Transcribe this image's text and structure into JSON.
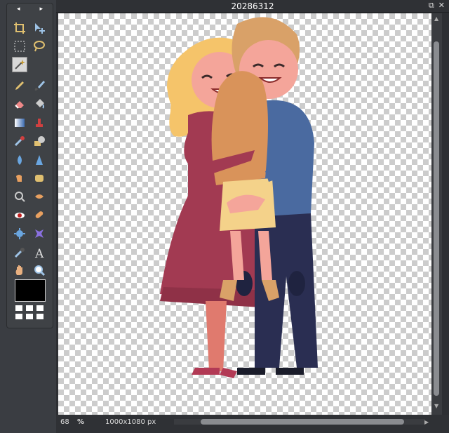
{
  "toolbox": {
    "nav_left": "◂",
    "nav_right": "▸",
    "tools": [
      {
        "name": "crop-icon",
        "row": 0,
        "col": 0
      },
      {
        "name": "move-icon",
        "row": 0,
        "col": 1
      },
      {
        "name": "marquee-icon",
        "row": 1,
        "col": 0
      },
      {
        "name": "lasso-icon",
        "row": 1,
        "col": 1
      },
      {
        "name": "magic-wand-icon",
        "row": 2,
        "col": 0,
        "active": true
      },
      {
        "name": "pencil-icon",
        "row": 3,
        "col": 0
      },
      {
        "name": "brush-icon",
        "row": 3,
        "col": 1
      },
      {
        "name": "eraser-icon",
        "row": 4,
        "col": 0
      },
      {
        "name": "paint-bucket-icon",
        "row": 4,
        "col": 1
      },
      {
        "name": "gradient-icon",
        "row": 5,
        "col": 0
      },
      {
        "name": "clone-stamp-icon",
        "row": 5,
        "col": 1
      },
      {
        "name": "color-replace-icon",
        "row": 6,
        "col": 0
      },
      {
        "name": "drawing-icon",
        "row": 6,
        "col": 1
      },
      {
        "name": "blur-icon",
        "row": 7,
        "col": 0
      },
      {
        "name": "sharpen-icon",
        "row": 7,
        "col": 1
      },
      {
        "name": "smudge-icon",
        "row": 8,
        "col": 0
      },
      {
        "name": "sponge-icon",
        "row": 8,
        "col": 1
      },
      {
        "name": "dodge-icon",
        "row": 9,
        "col": 0
      },
      {
        "name": "burn-icon",
        "row": 9,
        "col": 1
      },
      {
        "name": "red-eye-icon",
        "row": 10,
        "col": 0
      },
      {
        "name": "spot-heal-icon",
        "row": 10,
        "col": 1
      },
      {
        "name": "bloat-icon",
        "row": 11,
        "col": 0
      },
      {
        "name": "pinch-icon",
        "row": 11,
        "col": 1
      },
      {
        "name": "color-picker-icon",
        "row": 12,
        "col": 0
      },
      {
        "name": "type-icon",
        "row": 12,
        "col": 1,
        "glyph": "A"
      },
      {
        "name": "hand-icon",
        "row": 13,
        "col": 0
      },
      {
        "name": "zoom-icon",
        "row": 13,
        "col": 1
      }
    ],
    "foreground_color": "#000000"
  },
  "window": {
    "title": "20286312",
    "restore_glyph": "⧉",
    "close_glyph": "✕"
  },
  "status": {
    "zoom": "68",
    "percent": "%",
    "dimensions": "1000x1080 px"
  }
}
